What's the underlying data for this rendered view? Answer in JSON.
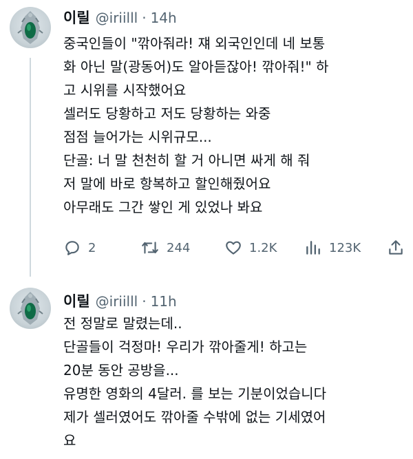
{
  "tweets": [
    {
      "author": {
        "name": "이릴",
        "handle": "@iriilll",
        "separator": "·",
        "time": "14h"
      },
      "lines": [
        "중국인들이 \"깎아줘라! 쟤 외국인인데 네 보통",
        "화 아닌 말(광동어)도 알아듣잖아! 깎아줘!\" 하",
        "고 시위를 시작했어요",
        "셀러도 당황하고 저도 당황하는 와중",
        "점점 늘어가는 시위규모...",
        "단골: 너 말 천천히 할 거 아니면 싸게 해 줘",
        "저 말에 바로 항복하고 할인해줬어요",
        "아무래도 그간 쌓인 게 있었나 봐요"
      ],
      "actions": {
        "replies": "2",
        "reposts": "244",
        "likes": "1.2K",
        "views": "123K"
      }
    },
    {
      "author": {
        "name": "이릴",
        "handle": "@iriilll",
        "separator": "·",
        "time": "11h"
      },
      "lines": [
        "전 정말로 말렸는데..",
        "단골들이 걱정마! 우리가 깎아줄게! 하고는",
        "20분 동안 공방을...",
        "유명한 영화의 4달러. 를 보는 기분이었습니다",
        "제가 셀러였어도 깎아줄 수밖에 없는 기세였어",
        "요"
      ]
    }
  ],
  "colors": {
    "text": "#0f1419",
    "secondary": "#536471",
    "thread_line": "#cfd9de"
  },
  "icons": [
    "reply-icon",
    "repost-icon",
    "like-icon",
    "views-icon",
    "share-icon",
    "avatar-pendant"
  ]
}
